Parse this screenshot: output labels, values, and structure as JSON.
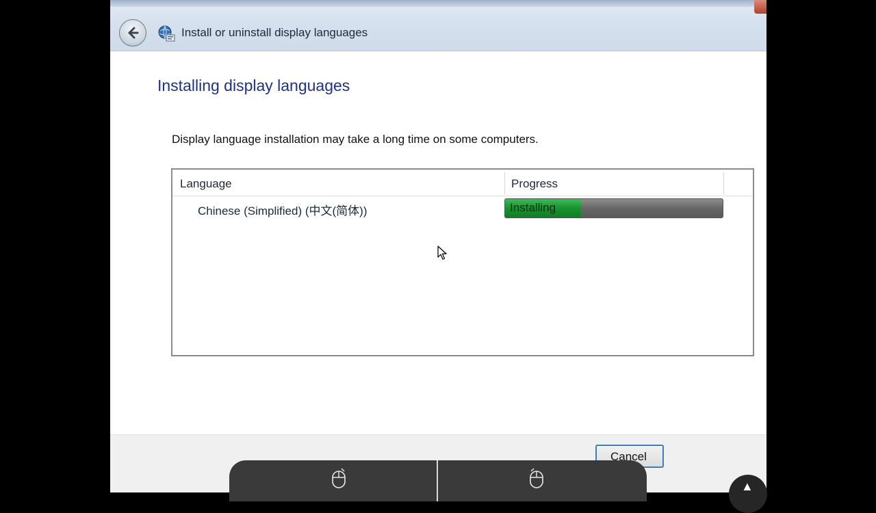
{
  "window": {
    "nav_title": "Install or uninstall display languages"
  },
  "page": {
    "heading": "Installing display languages",
    "description": "Display language installation may take a long time on some computers."
  },
  "list": {
    "columns": [
      "Language",
      "Progress"
    ],
    "rows": [
      {
        "language": "Chinese (Simplified) (中文(简体))",
        "status": "Installing",
        "progress": 0.35
      }
    ]
  },
  "buttons": {
    "cancel": "Cancel"
  },
  "colors": {
    "heading": "#1e3287",
    "progress_fill": "#17932f",
    "cancel_border": "#3c7fb1"
  },
  "icons": {
    "back": "back-arrow-icon",
    "app": "globe-language-icon",
    "cursor": "mouse-pointer-icon",
    "overlay_left": "mouse-left-click-icon",
    "overlay_right": "mouse-right-click-icon",
    "corner": "chevron-up-icon"
  }
}
